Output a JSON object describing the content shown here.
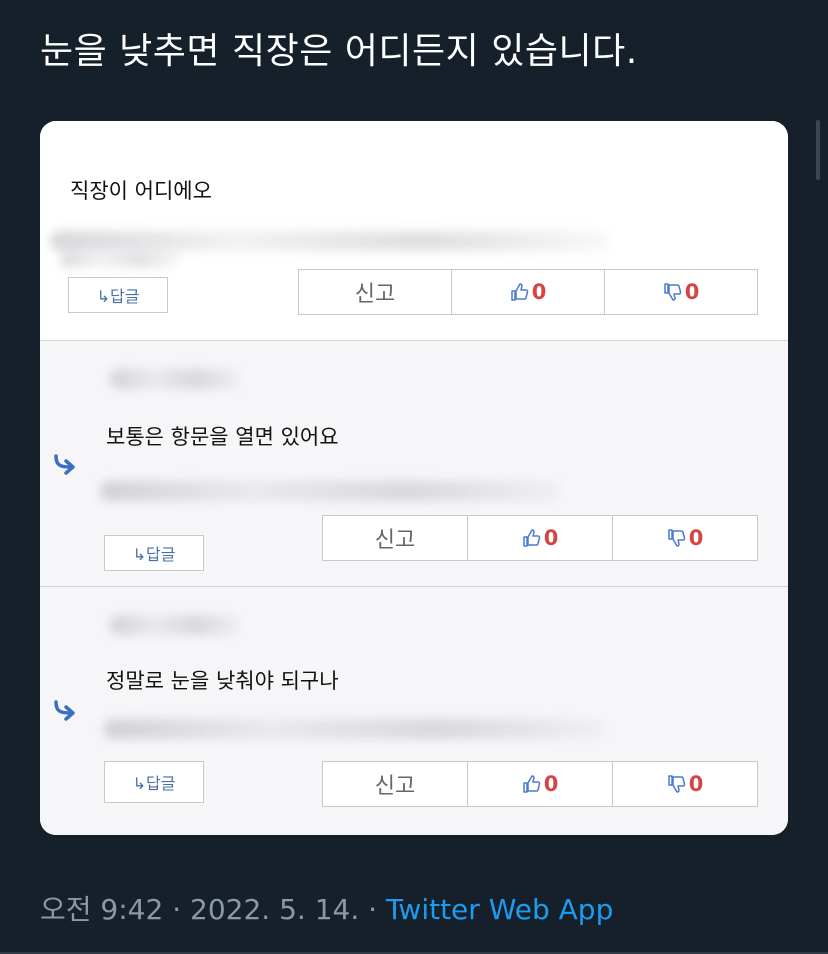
{
  "tweet": {
    "text": "눈을 낮추면 직장은 어디든지 있습니다.",
    "time": "오전 9:42",
    "separator": "·",
    "date": "2022. 5. 14.",
    "app": "Twitter Web App"
  },
  "comments": [
    {
      "body": "직장이 어디에오",
      "reply_label": "↳답글",
      "report_label": "신고",
      "likes": "0",
      "dislikes": "0"
    },
    {
      "body": "보통은 항문을 열면 있어요",
      "reply_label": "↳답글",
      "report_label": "신고",
      "likes": "0",
      "dislikes": "0"
    },
    {
      "body": "정말로 눈을 낮춰야 되구나",
      "reply_label": "↳답글",
      "report_label": "신고",
      "likes": "0",
      "dislikes": "0"
    }
  ],
  "icons": {
    "reply_arrow": "reply-arrow-icon",
    "like": "thumbs-up-icon",
    "dislike": "thumbs-down-icon"
  },
  "colors": {
    "background": "#15202b",
    "link": "#1d9bf0",
    "count": "#d64545",
    "reply_arrow": "#3b6fc4"
  }
}
